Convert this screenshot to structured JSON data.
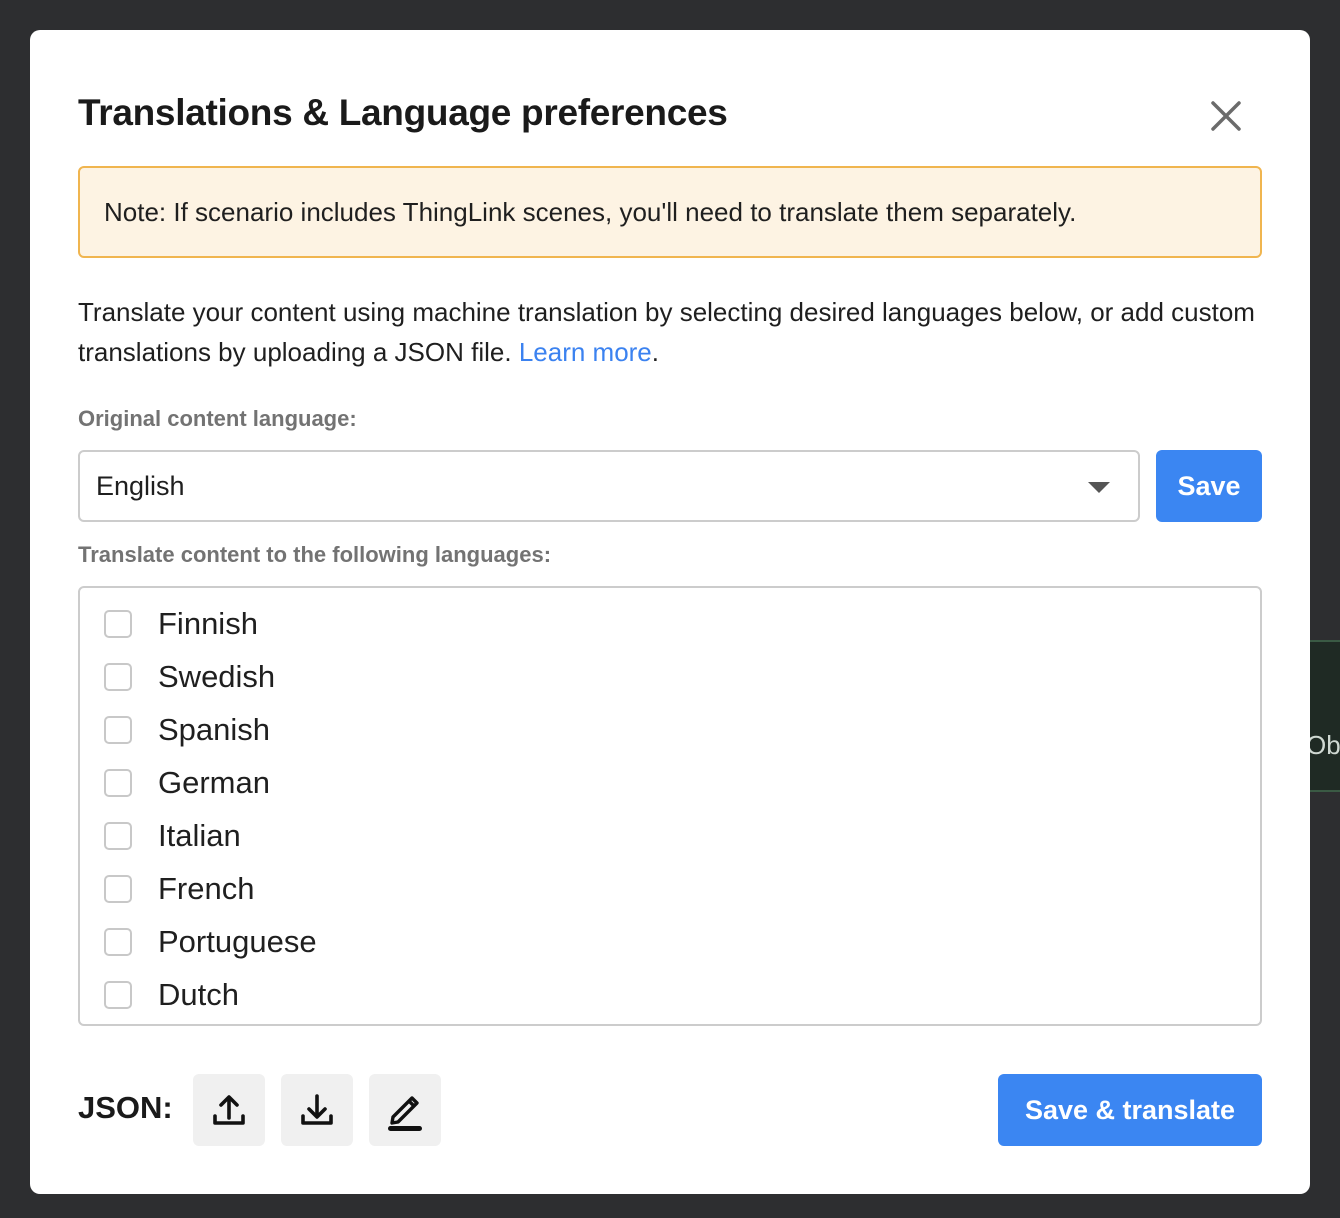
{
  "background": {
    "partial_text": "Obj"
  },
  "modal": {
    "title": "Translations & Language preferences",
    "close_icon": "close-icon",
    "note": "Note: If scenario includes ThingLink scenes, you'll need to translate them separately.",
    "intro_text": "Translate your content using machine translation by selecting desired languages below, or add custom translations by uploading a JSON file.",
    "learn_more_link": "Learn more",
    "intro_period": ".",
    "original_language": {
      "label": "Original content language:",
      "selected_value": "English",
      "save_label": "Save"
    },
    "target_languages": {
      "label": "Translate content to the following languages:",
      "items": [
        {
          "label": "Finnish",
          "checked": false
        },
        {
          "label": "Swedish",
          "checked": false
        },
        {
          "label": "Spanish",
          "checked": false
        },
        {
          "label": "German",
          "checked": false
        },
        {
          "label": "Italian",
          "checked": false
        },
        {
          "label": "French",
          "checked": false
        },
        {
          "label": "Portuguese",
          "checked": false
        },
        {
          "label": "Dutch",
          "checked": false
        }
      ]
    },
    "json_tools": {
      "label": "JSON:",
      "buttons": [
        "upload-icon",
        "download-icon",
        "edit-icon"
      ]
    },
    "save_translate_label": "Save & translate"
  },
  "colors": {
    "accent": "#3b86f2",
    "link": "#3b82f0",
    "note_bg": "#fdf3e3",
    "note_border": "#f0b54f",
    "overlay": "#2d2e30"
  }
}
